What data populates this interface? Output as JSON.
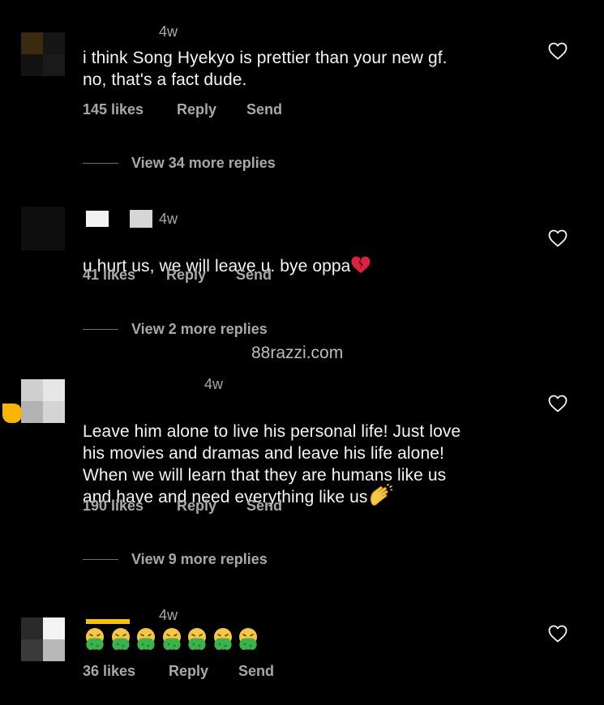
{
  "watermark": "88razzi.com",
  "comments": [
    {
      "time": "4w",
      "text": "i think Song Hyekyo is prettier than your new gf.\nno, that's a fact dude.",
      "likes": "145 likes",
      "reply": "Reply",
      "send": "Send",
      "view_replies": "View 34 more replies"
    },
    {
      "time": "4w",
      "text": "u hurt us, we will leave u. bye oppa",
      "emoji": "broken-heart-icon",
      "likes": "41 likes",
      "reply": "Reply",
      "send": "Send",
      "view_replies": "View 2 more replies"
    },
    {
      "time": "4w",
      "text": "Leave him alone to live his personal life! Just love\nhis movies and dramas and leave his life alone!\nWhen we will learn that they are humans like us\nand have and need everything like us",
      "emoji": "clapping-hands-icon",
      "likes": "190 likes",
      "reply": "Reply",
      "send": "Send",
      "view_replies": "View 9 more replies"
    },
    {
      "time": "4w",
      "emoji": "vomiting-face-icon",
      "emoji_count": 7,
      "likes": "36 likes",
      "reply": "Reply",
      "send": "Send"
    }
  ],
  "colors": {
    "background": "#000000",
    "text": "#f5f5f5",
    "secondary": "#a8a8a8"
  }
}
